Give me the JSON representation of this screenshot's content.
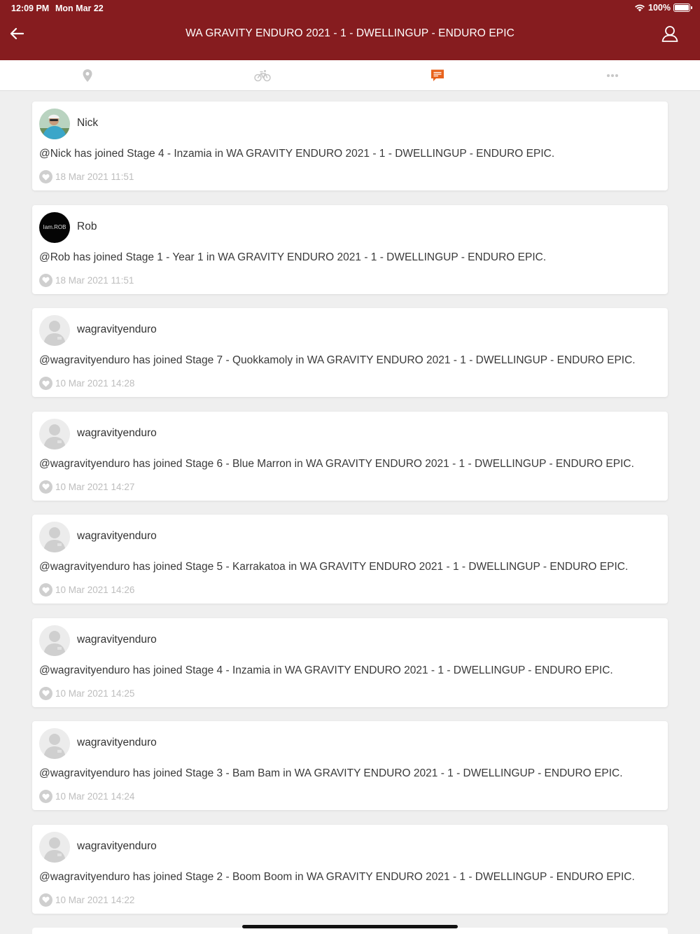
{
  "status_bar": {
    "time": "12:09 PM",
    "date": "Mon Mar 22",
    "battery": "100%"
  },
  "header": {
    "title": "WA GRAVITY ENDURO 2021 - 1 - DWELLINGUP - ENDURO EPIC",
    "background": "#861c1f"
  },
  "tabs": [
    {
      "icon": "location-pin-icon",
      "active": false
    },
    {
      "icon": "bicycle-icon",
      "active": false
    },
    {
      "icon": "chat-icon",
      "active": true,
      "color": "#e8631d"
    },
    {
      "icon": "more-icon",
      "active": false
    }
  ],
  "feed": [
    {
      "user": "Nick",
      "avatar": "photo",
      "message": "@Nick has joined Stage 4 - Inzamia in WA GRAVITY ENDURO 2021 - 1 - DWELLINGUP - ENDURO EPIC.",
      "timestamp": "18 Mar 2021 11:51"
    },
    {
      "user": "Rob",
      "avatar": "logo",
      "avatar_text": "Iam.ROB",
      "message": "@Rob has joined Stage 1 - Year 1 in WA GRAVITY ENDURO 2021 - 1 - DWELLINGUP - ENDURO EPIC.",
      "timestamp": "18 Mar 2021 11:51"
    },
    {
      "user": "wagravityenduro",
      "avatar": "placeholder",
      "message": "@wagravityenduro has joined Stage 7 - Quokkamoly in WA GRAVITY ENDURO 2021 - 1 - DWELLINGUP - ENDURO EPIC.",
      "timestamp": "10 Mar 2021 14:28"
    },
    {
      "user": "wagravityenduro",
      "avatar": "placeholder",
      "message": "@wagravityenduro has joined Stage 6 - Blue Marron in WA GRAVITY ENDURO 2021 - 1 - DWELLINGUP - ENDURO EPIC.",
      "timestamp": "10 Mar 2021 14:27"
    },
    {
      "user": "wagravityenduro",
      "avatar": "placeholder",
      "message": "@wagravityenduro has joined Stage 5 - Karrakatoa in WA GRAVITY ENDURO 2021 - 1 - DWELLINGUP - ENDURO EPIC.",
      "timestamp": "10 Mar 2021 14:26"
    },
    {
      "user": "wagravityenduro",
      "avatar": "placeholder",
      "message": "@wagravityenduro has joined Stage 4 - Inzamia in WA GRAVITY ENDURO 2021 - 1 - DWELLINGUP - ENDURO EPIC.",
      "timestamp": "10 Mar 2021 14:25"
    },
    {
      "user": "wagravityenduro",
      "avatar": "placeholder",
      "message": "@wagravityenduro has joined Stage 3 - Bam Bam in WA GRAVITY ENDURO 2021 - 1 - DWELLINGUP - ENDURO EPIC.",
      "timestamp": "10 Mar 2021 14:24"
    },
    {
      "user": "wagravityenduro",
      "avatar": "placeholder",
      "message": "@wagravityenduro has joined Stage 2 - Boom Boom in WA GRAVITY ENDURO 2021 - 1 - DWELLINGUP - ENDURO EPIC.",
      "timestamp": "10 Mar 2021 14:22"
    }
  ]
}
